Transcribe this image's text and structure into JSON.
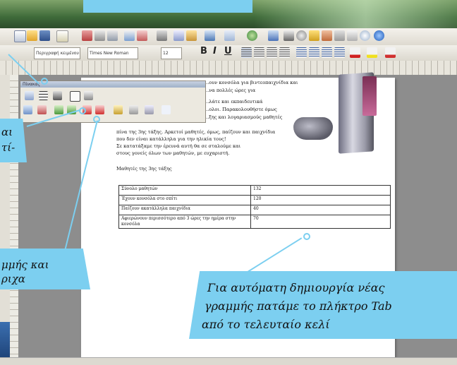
{
  "toolbar": {
    "font_name": "Περιγραφή κειμένου",
    "font_family": "Times New Roman",
    "font_size": "12",
    "bold": "B",
    "italic": "I",
    "underline": "U"
  },
  "floating_toolbar": {
    "title": "Πίνακας"
  },
  "document": {
    "lines": [
      "πίνα της 3ης τάξης. Αρκετοί μαθητές, όμως, παίζουν και παιχνίδια",
      "που δεν είναι κατάλληλα για την ηλικία τους!",
      "Σε κατατάξαμε την έρευνά αυτή θα σε σταλούμε και",
      "στους γονείς όλων των μαθητών, με ευχαριστή."
    ],
    "right_lines": [
      "...ουν κονσόλα για βιντεοπαιχνίδια και",
      "...να πολλές ώρες για",
      "...λάτε και εκπαιδευτικά",
      "...ολοι. Παρακολουθήστε όμως",
      "...ξης και λογαριασμούς μαθητές"
    ],
    "heading": "Μαθητές της 3ης τάξης",
    "table": [
      [
        "Σύνολο μαθητών",
        "132"
      ],
      [
        "Έχουν κονσόλα στο σπίτι",
        "120"
      ],
      [
        "Παίζουν ακατάλληλα παιχνίδια",
        "40"
      ],
      [
        "Αφιερώνουν περισσότερο από 3 ώρες την ημέρα στην κονσόλα",
        "70"
      ]
    ]
  },
  "callouts": {
    "left_middle": [
      "αι",
      "τί-"
    ],
    "left_bottom": [
      "μμής και",
      "ριχα"
    ],
    "bottom_right": [
      "Για αυτόματη δημιουργία νέας",
      "γραμμής πατάμε το πλήκτρο Tab",
      "από το τελευταίο κελί"
    ]
  },
  "colors": {
    "callout": "#7ccff0",
    "window_title": "#3f6b3a"
  }
}
